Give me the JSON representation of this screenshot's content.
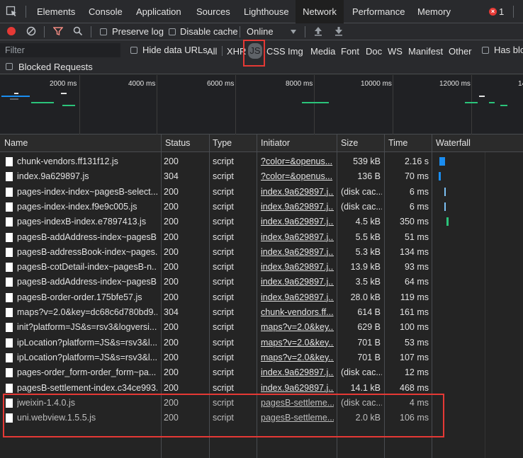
{
  "tabs": [
    "Elements",
    "Console",
    "Application",
    "Sources",
    "Lighthouse",
    "Network",
    "Performance",
    "Memory"
  ],
  "error_count": "1",
  "toolbar": {
    "preserve_log": "Preserve log",
    "disable_cache": "Disable cache",
    "throttling": "Online"
  },
  "filter": {
    "placeholder": "Filter",
    "hide_data_urls": "Hide data URLs",
    "types": [
      "All",
      "XHR",
      "JS",
      "CSS",
      "Img",
      "Media",
      "Font",
      "Doc",
      "WS",
      "Manifest",
      "Other"
    ],
    "has_blocked": "Has blo",
    "blocked_requests": "Blocked Requests"
  },
  "overview": {
    "ticks": [
      "2000 ms",
      "4000 ms",
      "6000 ms",
      "8000 ms",
      "10000 ms",
      "12000 ms",
      "14"
    ]
  },
  "columns": [
    "Name",
    "Status",
    "Type",
    "Initiator",
    "Size",
    "Time",
    "Waterfall"
  ],
  "rows": [
    {
      "name": "chunk-vendors.ff131f12.js",
      "status": "200",
      "type": "script",
      "initiator": "?color=&openus...",
      "size": "539 kB",
      "time": "2.16 s",
      "link": true
    },
    {
      "name": "index.9a629897.js",
      "status": "304",
      "type": "script",
      "initiator": "?color=&openus...",
      "size": "136 B",
      "time": "70 ms",
      "link": true
    },
    {
      "name": "pages-index-index~pagesB-select...",
      "status": "200",
      "type": "script",
      "initiator": "index.9a629897.j...",
      "size": "(disk cac...",
      "time": "6 ms",
      "link": true
    },
    {
      "name": "pages-index-index.f9e9c005.js",
      "status": "200",
      "type": "script",
      "initiator": "index.9a629897.j...",
      "size": "(disk cac...",
      "time": "6 ms",
      "link": true
    },
    {
      "name": "pages-indexB-index.e7897413.js",
      "status": "200",
      "type": "script",
      "initiator": "index.9a629897.j...",
      "size": "4.5 kB",
      "time": "350 ms",
      "link": true
    },
    {
      "name": "pagesB-addAddress-index~pagesB...",
      "status": "200",
      "type": "script",
      "initiator": "index.9a629897.j...",
      "size": "5.5 kB",
      "time": "51 ms",
      "link": true
    },
    {
      "name": "pagesB-addressBook-index~pages...",
      "status": "200",
      "type": "script",
      "initiator": "index.9a629897.j...",
      "size": "5.3 kB",
      "time": "134 ms",
      "link": true
    },
    {
      "name": "pagesB-cotDetail-index~pagesB-n...",
      "status": "200",
      "type": "script",
      "initiator": "index.9a629897.j...",
      "size": "13.9 kB",
      "time": "93 ms",
      "link": true
    },
    {
      "name": "pagesB-addAddress-index~pagesB...",
      "status": "200",
      "type": "script",
      "initiator": "index.9a629897.j...",
      "size": "3.5 kB",
      "time": "64 ms",
      "link": true
    },
    {
      "name": "pagesB-order-order.175bfe57.js",
      "status": "200",
      "type": "script",
      "initiator": "index.9a629897.j...",
      "size": "28.0 kB",
      "time": "119 ms",
      "link": true
    },
    {
      "name": "maps?v=2.0&key=dc68c6d780bd9...",
      "status": "304",
      "type": "script",
      "initiator": "chunk-vendors.ff...",
      "size": "614 B",
      "time": "161 ms",
      "link": true
    },
    {
      "name": "init?platform=JS&s=rsv3&logversi...",
      "status": "200",
      "type": "script",
      "initiator": "maps?v=2.0&key...",
      "size": "629 B",
      "time": "100 ms",
      "link": true
    },
    {
      "name": "ipLocation?platform=JS&s=rsv3&l...",
      "status": "200",
      "type": "script",
      "initiator": "maps?v=2.0&key...",
      "size": "701 B",
      "time": "53 ms",
      "link": true
    },
    {
      "name": "ipLocation?platform=JS&s=rsv3&l...",
      "status": "200",
      "type": "script",
      "initiator": "maps?v=2.0&key...",
      "size": "701 B",
      "time": "107 ms",
      "link": true
    },
    {
      "name": "pages-order_form-order_form~pa...",
      "status": "200",
      "type": "script",
      "initiator": "index.9a629897.j...",
      "size": "(disk cac...",
      "time": "12 ms",
      "link": true
    },
    {
      "name": "pagesB-settlement-index.c34ce993...",
      "status": "200",
      "type": "script",
      "initiator": "index.9a629897.j...",
      "size": "14.1 kB",
      "time": "468 ms",
      "link": true
    },
    {
      "name": "jweixin-1.4.0.js",
      "status": "200",
      "type": "script",
      "initiator": "pagesB-settleme...",
      "size": "(disk cac...",
      "time": "4 ms",
      "link": true
    },
    {
      "name": "uni.webview.1.5.5.js",
      "status": "200",
      "type": "script",
      "initiator": "pagesB-settleme...",
      "size": "2.0 kB",
      "time": "106 ms",
      "link": true
    }
  ],
  "colors": {
    "accent": "#8ab4f8",
    "record": "#e53935",
    "filter_icon": "#f28b82",
    "highlight": "#e53935",
    "waterfall": "#1a8df0"
  }
}
